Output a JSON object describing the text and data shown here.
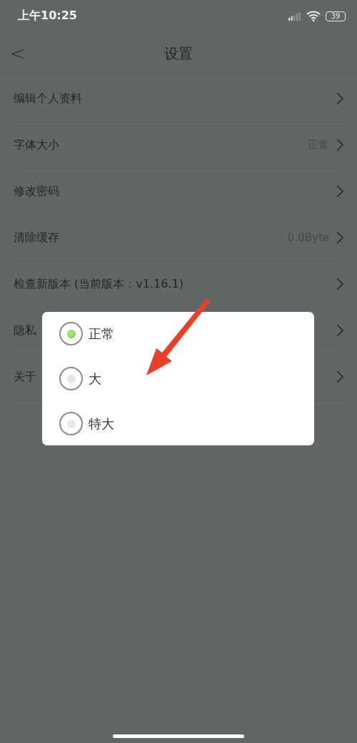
{
  "status_bar": {
    "time": "上午10:25",
    "battery": "39"
  },
  "header": {
    "back": "<",
    "title": "设置"
  },
  "rows": [
    {
      "label": "编辑个人资料"
    },
    {
      "label": "字体大小",
      "value": "正常"
    },
    {
      "label": "修改密码"
    },
    {
      "label": "清除缓存",
      "value": "0.0Byte"
    },
    {
      "label": "检查新版本 (当前版本：v1.16.1)"
    },
    {
      "label": "隐私"
    },
    {
      "label": "关于"
    }
  ],
  "dialog": {
    "options": [
      {
        "label": "正常",
        "selected": true
      },
      {
        "label": "大",
        "selected": false
      },
      {
        "label": "特大",
        "selected": false
      }
    ]
  }
}
